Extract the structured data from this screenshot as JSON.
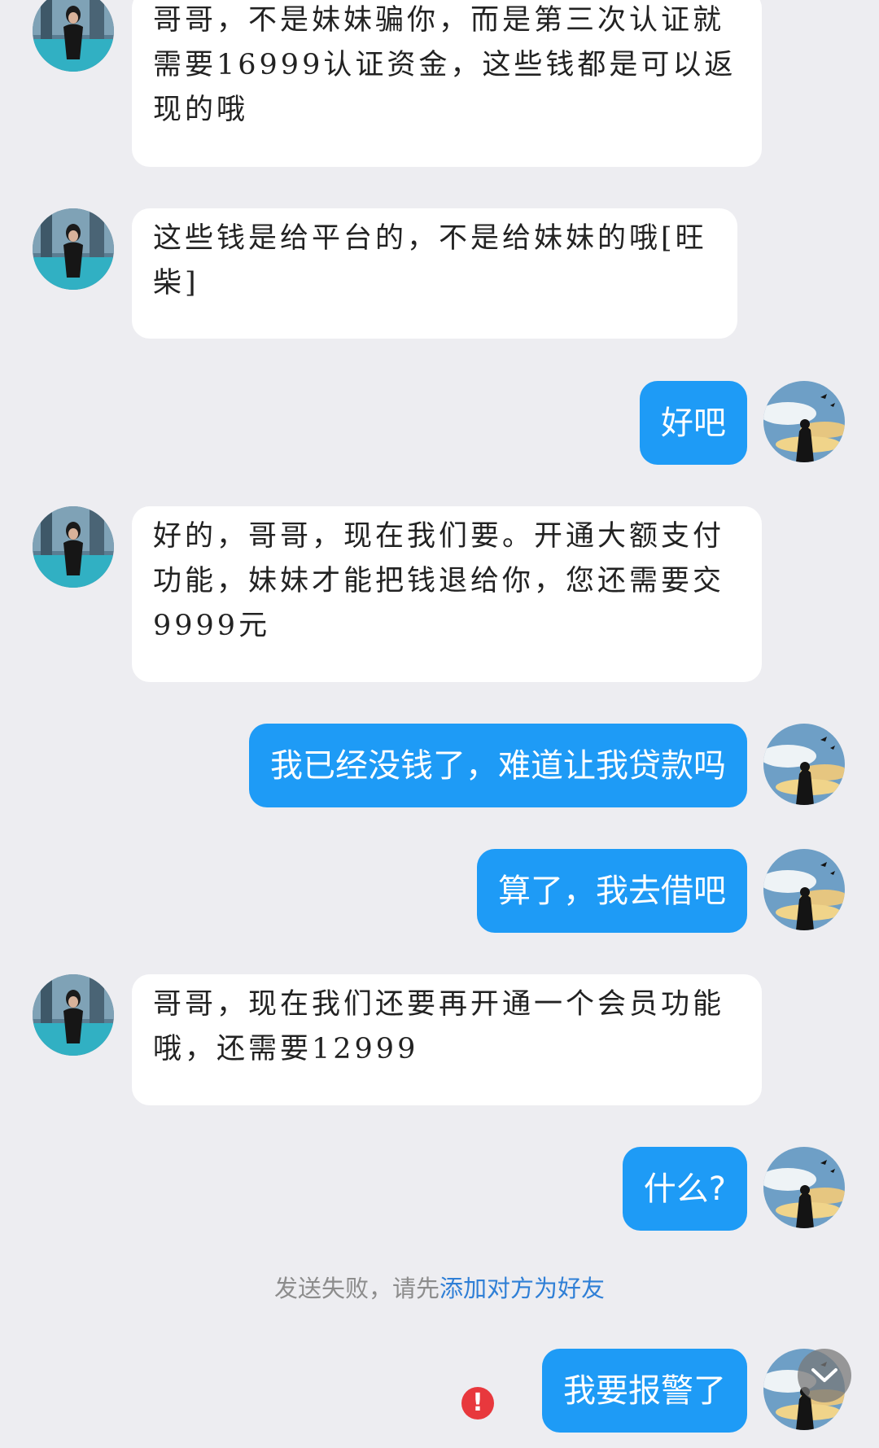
{
  "messages": [
    {
      "side": "recv",
      "text": "哥哥，不是妹妹骗你，而是第三次认证就需要16999认证资金，这些钱都是可以返现的哦"
    },
    {
      "side": "recv",
      "text": "这些钱是给平台的，不是给妹妹的哦[旺柴]"
    },
    {
      "side": "sent",
      "text": "好吧"
    },
    {
      "side": "recv",
      "text": "好的，哥哥，现在我们要。开通大额支付功能，妹妹才能把钱退给你，您还需要交9999元"
    },
    {
      "side": "sent",
      "text": "我已经没钱了，难道让我贷款吗"
    },
    {
      "side": "sent",
      "text": "算了，我去借吧"
    },
    {
      "side": "recv",
      "text": "哥哥，现在我们还要再开通一个会员功能哦，还需要12999"
    },
    {
      "side": "sent",
      "text": "什么?"
    },
    {
      "side": "sent",
      "text": "我要报警了"
    }
  ],
  "notice": {
    "prefix": "发送失败，请先",
    "link": "添加对方为好友"
  },
  "icons": {
    "fail": "exclamation-icon",
    "scroll": "chevron-down-icon"
  },
  "colors": {
    "background": "#ededf1",
    "sent_bubble": "#1e9bf6",
    "recv_bubble": "#ffffff",
    "link": "#2f7fd6",
    "fail": "#e8383d"
  }
}
